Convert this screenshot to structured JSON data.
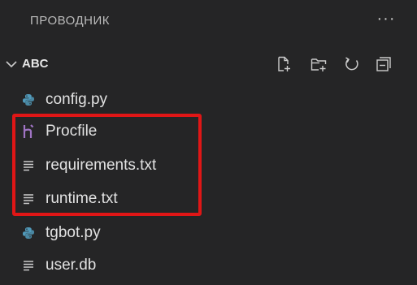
{
  "explorer": {
    "title": "ПРОВОДНИК",
    "more_label": "···"
  },
  "folder": {
    "name": "ABC",
    "expanded": true,
    "actions": [
      {
        "name": "new-file-icon"
      },
      {
        "name": "new-folder-icon"
      },
      {
        "name": "refresh-icon"
      },
      {
        "name": "collapse-all-icon"
      }
    ]
  },
  "files": [
    {
      "name": "config.py",
      "icon": "python-icon"
    },
    {
      "name": "Procfile",
      "icon": "heroku-icon"
    },
    {
      "name": "requirements.txt",
      "icon": "text-file-icon"
    },
    {
      "name": "runtime.txt",
      "icon": "text-file-icon"
    },
    {
      "name": "tgbot.py",
      "icon": "python-icon"
    },
    {
      "name": "user.db",
      "icon": "text-file-icon"
    }
  ],
  "colors": {
    "background": "#252526",
    "text": "#cccccc",
    "python_icon": "#519aba",
    "heroku_icon": "#a074c4",
    "highlight": "#e01616"
  }
}
